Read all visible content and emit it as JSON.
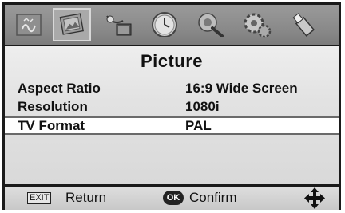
{
  "menu": {
    "tabs": [
      {
        "name": "audio-icon",
        "selected": false
      },
      {
        "name": "picture-icon",
        "selected": true
      },
      {
        "name": "channel-icon",
        "selected": false
      },
      {
        "name": "time-icon",
        "selected": false
      },
      {
        "name": "setup-icon",
        "selected": false
      },
      {
        "name": "system-icon",
        "selected": false
      },
      {
        "name": "usb-icon",
        "selected": false
      }
    ]
  },
  "page": {
    "title": "Picture",
    "rows": [
      {
        "label": "Aspect Ratio",
        "value": "16:9 Wide Screen",
        "highlighted": false
      },
      {
        "label": "Resolution",
        "value": "1080i",
        "highlighted": false
      },
      {
        "label": "TV Format",
        "value": "PAL",
        "highlighted": true
      }
    ]
  },
  "footer": {
    "exit_key": "EXIT",
    "exit_label": "Return",
    "ok_key": "OK",
    "ok_label": "Confirm",
    "nav_icon": "navigation-arrows-icon"
  }
}
